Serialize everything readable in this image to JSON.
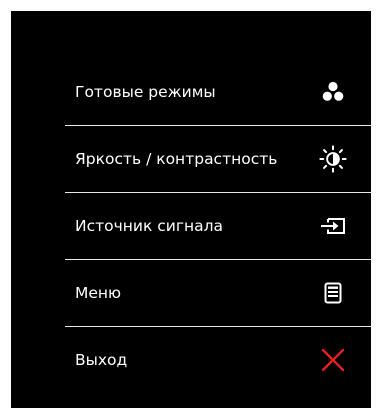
{
  "menu": {
    "items": [
      {
        "label": "Готовые режимы",
        "icon": "preset-modes-icon"
      },
      {
        "label": "Яркость / контрастность",
        "icon": "brightness-contrast-icon"
      },
      {
        "label": "Источник сигнала",
        "icon": "input-source-icon"
      },
      {
        "label": "Меню",
        "icon": "menu-icon"
      },
      {
        "label": "Выход",
        "icon": "close-icon",
        "icon_color": "#e32020"
      }
    ]
  }
}
